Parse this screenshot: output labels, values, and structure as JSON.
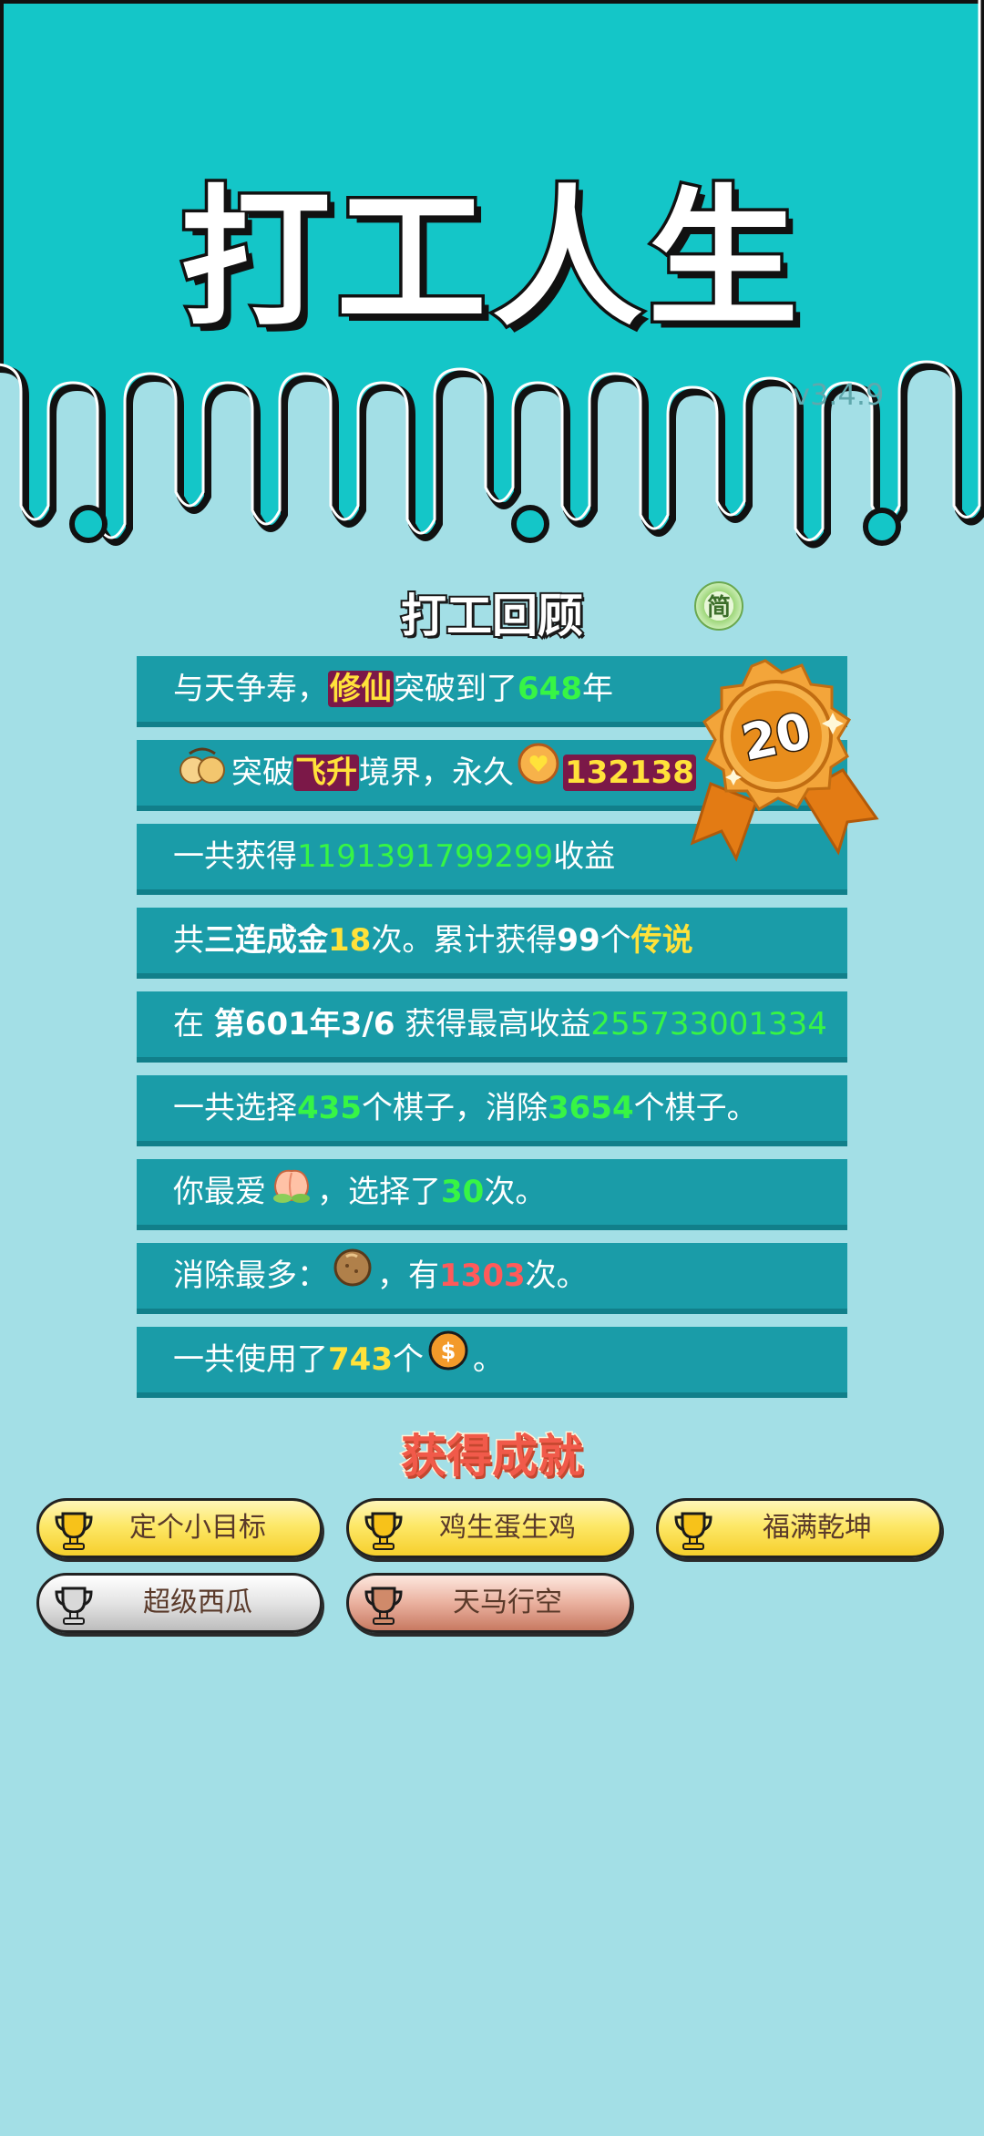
{
  "app": {
    "title": "打工人生",
    "version": "v3.4.9"
  },
  "review": {
    "title": "打工回顾",
    "lang_button": "简",
    "badge_level": "20",
    "rows": [
      {
        "p1": "与天争寿，",
        "tag": "修仙",
        "p2": "突破到了",
        "v1": "648",
        "p3": "年"
      },
      {
        "p1": "突破",
        "tag": "飞升",
        "p2": "境界，永久",
        "v1": "132138"
      },
      {
        "p1": "一共获得",
        "v1": "1191391799299",
        "p2": "收益"
      },
      {
        "p1": "共",
        "v1": "三连成金",
        "v2": "18",
        "p2": "次。累计获得",
        "v3": "99",
        "p3": "个",
        "v4": "传说"
      },
      {
        "p1": "在 ",
        "v1": "第601年3/6",
        "p2": " 获得最高收益",
        "v2": "255733001334"
      },
      {
        "p1": "一共选择",
        "v1": "435",
        "p2": "个棋子，消除",
        "v2": "3654",
        "p3": "个棋子。"
      },
      {
        "p1": "你最爱",
        "p2": "，选择了",
        "v1": "30",
        "p3": "次。"
      },
      {
        "p1": "消除最多：",
        "p2": "，有",
        "v1": "1303",
        "p3": "次。"
      },
      {
        "p1": "一共使用了",
        "v1": "743",
        "p2": "个",
        "p3": "。"
      }
    ]
  },
  "achievements": {
    "title": "获得成就",
    "items": [
      {
        "label": "定个小目标",
        "tier": "gold"
      },
      {
        "label": "鸡生蛋生鸡",
        "tier": "gold"
      },
      {
        "label": "福满乾坤",
        "tier": "gold"
      },
      {
        "label": "超级西瓜",
        "tier": "silver"
      },
      {
        "label": "天马行空",
        "tier": "bronze"
      }
    ]
  },
  "colors": {
    "accent_teal": "#14c6c8",
    "page_bg": "#a3dfe6",
    "row_bg": "#1a9ca8",
    "value_green": "#37f545",
    "value_yellow": "#ffe23a",
    "value_red": "#ff5a5a"
  }
}
